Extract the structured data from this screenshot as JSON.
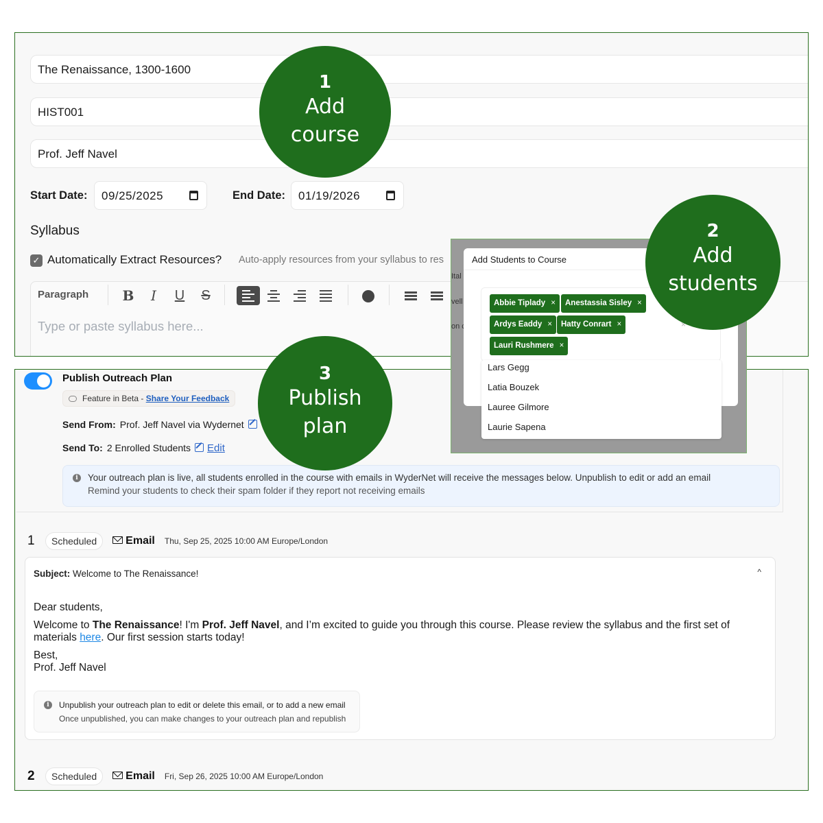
{
  "course_form": {
    "title": "The Renaissance, 1300-1600",
    "code": "HIST001",
    "instructor": "Prof. Jeff Navel",
    "start_label": "Start Date:",
    "start_date": "09/25/2025",
    "end_label": "End Date:",
    "end_date": "01/19/2026",
    "syllabus_heading": "Syllabus",
    "extract_checkbox_label": "Automatically Extract Resources?",
    "extract_checked": true,
    "extract_hint": "Auto-apply resources from your syllabus to res",
    "editor": {
      "block_style": "Paragraph",
      "bold": "B",
      "italic": "I",
      "underline": "U",
      "strike": "S",
      "placeholder": "Type or paste syllabus here..."
    }
  },
  "modal": {
    "title": "Add Students to Course",
    "background_fragments": [
      "Ital",
      "vell",
      "on c"
    ],
    "selected_students": [
      "Abbie Tiplady",
      "Anestassia Sisley",
      "Ardys Eaddy",
      "Hatty Conrart",
      "Lauri Rushmere"
    ],
    "tag_remove": "×",
    "clear": "×",
    "dropdown_options": [
      "Lars Gegg",
      "Latia Bouzek",
      "Lauree Gilmore",
      "Laurie Sapena"
    ]
  },
  "outreach": {
    "toggle_on": true,
    "title": "Publish Outreach Plan",
    "beta_text": "Feature in Beta - ",
    "beta_link": "Share Your Feedback",
    "send_from_label": "Send From:",
    "send_from_value": "Prof. Jeff Navel via Wydernet",
    "send_to_label": "Send To:",
    "send_to_value": "2 Enrolled Students",
    "edit_link": "Edit",
    "alert_line1": "Your outreach plan is live, all students enrolled in the course with emails in WyderNet will receive the messages below. Unpublish to edit or add an email",
    "alert_line2": "Remind your students to check their spam folder if they report not receiving emails",
    "emails": [
      {
        "index": "1",
        "status": "Scheduled",
        "type": "Email",
        "datetime": "Thu, Sep 25, 2025 10:00 AM Europe/London",
        "subject_label": "Subject:",
        "subject": "Welcome to The Renaissance!",
        "greeting": "Dear students,",
        "body_1": "Welcome to ",
        "body_bold_1": "The Renaissance",
        "body_2": "! I'm ",
        "body_bold_2": "Prof. Jeff Navel",
        "body_3": ", and I’m excited to guide you through this course. Please review the syllabus and the first set of materials ",
        "body_link": "here",
        "body_4": ". Our first session starts today!",
        "signoff": "Best,",
        "signature": "Prof. Jeff Navel",
        "note_line1": "Unpublish your outreach plan to edit or delete this email, or to add a new email",
        "note_line2": "Once unpublished, you can make changes to your outreach plan and republish"
      },
      {
        "index": "2",
        "status": "Scheduled",
        "type": "Email",
        "datetime": "Fri, Sep 26, 2025 10:00 AM Europe/London"
      }
    ]
  },
  "steps": [
    {
      "number": "1",
      "line1": "Add",
      "line2": "course"
    },
    {
      "number": "2",
      "line1": "Add",
      "line2": "students"
    },
    {
      "number": "3",
      "line1": "Publish",
      "line2": "plan"
    }
  ],
  "colors": {
    "step_green": "#1f6e1d",
    "toggle_blue": "#1e8fff",
    "link_blue": "#2f67c9",
    "alert_bg": "#edf4fe"
  }
}
